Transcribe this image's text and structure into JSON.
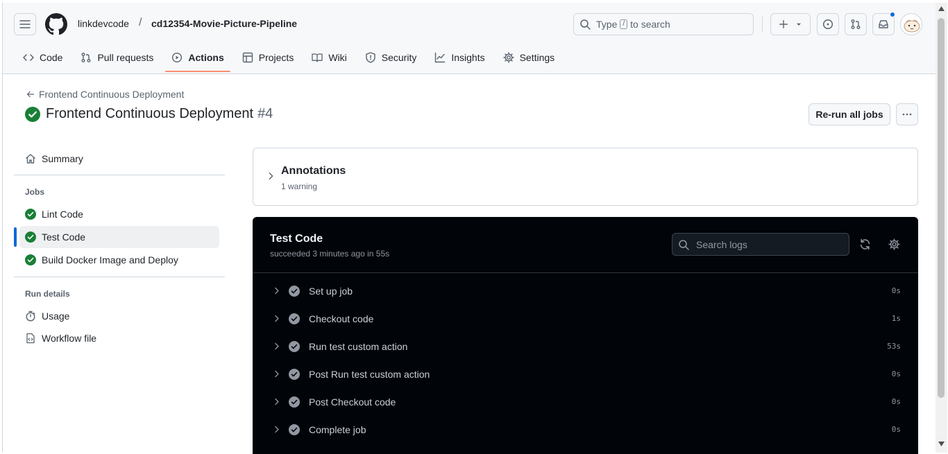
{
  "header": {
    "owner": "linkdevcode",
    "separator": "/",
    "repo": "cd12354-Movie-Picture-Pipeline",
    "search_prefix": "Type",
    "search_key": "/",
    "search_suffix": "to search"
  },
  "tabs": [
    {
      "label": "Code",
      "icon": "code-icon"
    },
    {
      "label": "Pull requests",
      "icon": "pull-request-icon"
    },
    {
      "label": "Actions",
      "icon": "play-icon",
      "active": true
    },
    {
      "label": "Projects",
      "icon": "table-icon"
    },
    {
      "label": "Wiki",
      "icon": "book-icon"
    },
    {
      "label": "Security",
      "icon": "shield-icon"
    },
    {
      "label": "Insights",
      "icon": "graph-icon"
    },
    {
      "label": "Settings",
      "icon": "gear-icon"
    }
  ],
  "run": {
    "back_label": "Frontend Continuous Deployment",
    "title": "Frontend Continuous Deployment",
    "number": "#4",
    "rerun_label": "Re-run all jobs"
  },
  "sidebar": {
    "summary": "Summary",
    "jobs_heading": "Jobs",
    "jobs": [
      {
        "label": "Lint Code"
      },
      {
        "label": "Test Code",
        "selected": true
      },
      {
        "label": "Build Docker Image and Deploy"
      }
    ],
    "run_details_heading": "Run details",
    "usage": "Usage",
    "workflow_file": "Workflow file"
  },
  "annotations": {
    "title": "Annotations",
    "subtitle": "1 warning"
  },
  "job": {
    "title": "Test Code",
    "subtitle": "succeeded 3 minutes ago in 55s",
    "search_placeholder": "Search logs",
    "steps": [
      {
        "label": "Set up job",
        "time": "0s"
      },
      {
        "label": "Checkout code",
        "time": "1s"
      },
      {
        "label": "Run test custom action",
        "time": "53s"
      },
      {
        "label": "Post Run test custom action",
        "time": "0s"
      },
      {
        "label": "Post Checkout code",
        "time": "0s"
      },
      {
        "label": "Complete job",
        "time": "0s"
      }
    ]
  },
  "colors": {
    "success": "#1a7f37",
    "tab_underline": "#fd8c73",
    "selected_bar": "#0969da",
    "log_bg": "#010409"
  }
}
